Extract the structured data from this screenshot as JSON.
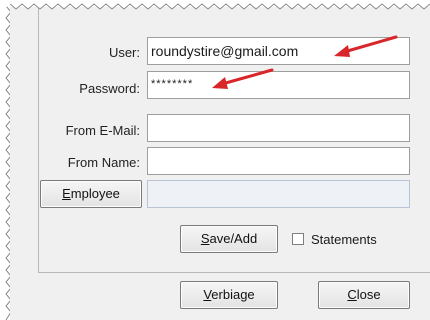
{
  "form": {
    "user_label": "User:",
    "user_value": "roundystire@gmail.com",
    "password_label": "Password:",
    "password_value": "********",
    "from_email_label": "From E-Mail:",
    "from_email_value": "",
    "from_name_label": "From Name:",
    "from_name_value": "",
    "employee_button": {
      "mnemonic": "E",
      "rest": "mployee"
    },
    "employee_value": ""
  },
  "actions": {
    "save_add": {
      "mnemonic": "S",
      "rest": "ave/Add"
    },
    "statements_label": "Statements",
    "statements_checked": false,
    "verbiage": {
      "mnemonic": "V",
      "rest": "erbiage"
    },
    "close": {
      "mnemonic": "C",
      "rest": "lose"
    }
  },
  "annotation_color": "#d9262b"
}
